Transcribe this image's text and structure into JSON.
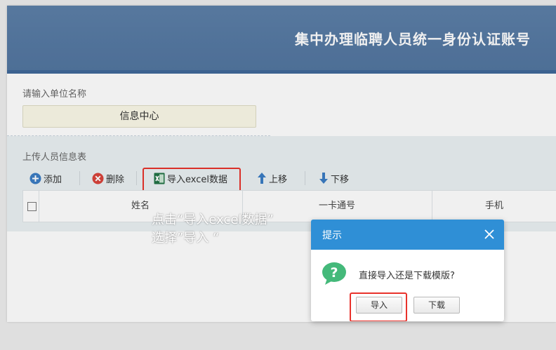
{
  "header": {
    "title": "集中办理临聘人员统一身份认证账号"
  },
  "unit": {
    "label": "请输入单位名称",
    "value": "信息中心"
  },
  "upload": {
    "label": "上传人员信息表"
  },
  "toolbar": {
    "add_label": "添加",
    "delete_label": "删除",
    "import_label": "导入excel数据",
    "up_label": "上移",
    "down_label": "下移"
  },
  "table": {
    "columns": [
      "姓名",
      "一卡通号",
      "手机"
    ]
  },
  "annotation": {
    "text": "点击“导入excel数据”\n选择”导入 “"
  },
  "dialog": {
    "title": "提示",
    "message": "直接导入还是下载模版?",
    "import_label": "导入",
    "download_label": "下载"
  },
  "colors": {
    "header_bg": "#5a7ea7",
    "dialog_header": "#2f8fd6",
    "highlight": "#e8322b",
    "question_icon": "#44b97a"
  }
}
